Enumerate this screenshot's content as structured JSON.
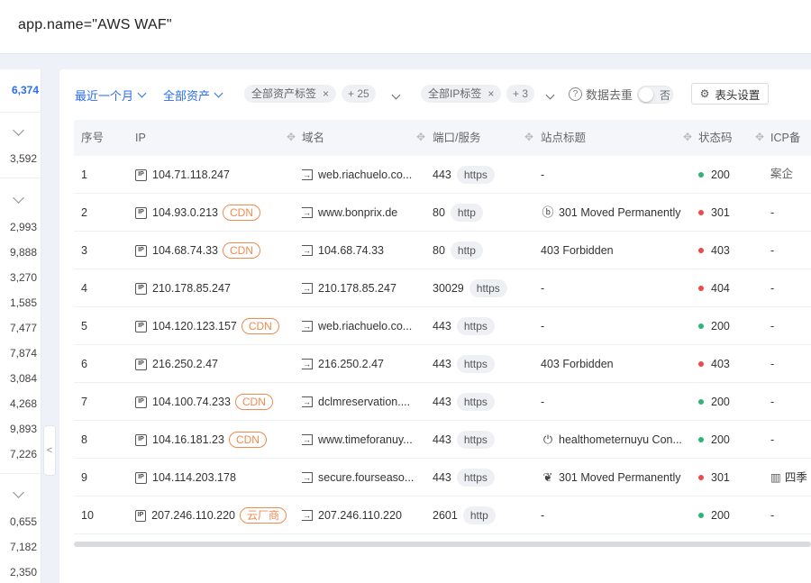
{
  "query": "app.name=\"AWS WAF\"",
  "sidebar": {
    "total": "6,374",
    "numbers": [
      "3,592",
      "2,993",
      "9,888",
      "3,270",
      "1,585",
      "7,477",
      "7,874",
      "3,084",
      "4,268",
      "9,893",
      "7,226",
      "0,655",
      "7,182",
      "2,350"
    ]
  },
  "collapse_label": "<",
  "filters": {
    "time_range": "最近一个月",
    "asset_scope": "全部资产",
    "asset_tag": "全部资产标签",
    "asset_tag_more": "+ 25",
    "ip_tag": "全部IP标签",
    "ip_tag_more": "+ 3",
    "dedupe_label": "数据去重",
    "dedupe_value": "否",
    "column_settings": "表头设置",
    "help_glyph": "?",
    "close_glyph": "×"
  },
  "columns": [
    "序号",
    "IP",
    "域名",
    "端口/服务",
    "站点标题",
    "状态码",
    "ICP备案企"
  ],
  "rows": [
    {
      "no": "1",
      "ip": "104.71.118.247",
      "badge": "",
      "domain": "web.riachuelo.co...",
      "port": "443",
      "service": "https",
      "site_icon": "",
      "title": "-",
      "status": "200",
      "status_color": "#2bb673",
      "icp_icon": "",
      "icp": "-"
    },
    {
      "no": "2",
      "ip": "104.93.0.213",
      "badge": "CDN",
      "domain": "www.bonprix.de",
      "port": "80",
      "service": "http",
      "site_icon": "ⓑ",
      "title": "301 Moved Permanently",
      "status": "301",
      "status_color": "#f0474a",
      "icp_icon": "",
      "icp": "-"
    },
    {
      "no": "3",
      "ip": "104.68.74.33",
      "badge": "CDN",
      "domain": "104.68.74.33",
      "port": "80",
      "service": "http",
      "site_icon": "",
      "title": "403 Forbidden",
      "status": "403",
      "status_color": "#f0474a",
      "icp_icon": "",
      "icp": "-"
    },
    {
      "no": "4",
      "ip": "210.178.85.247",
      "badge": "",
      "domain": "210.178.85.247",
      "port": "30029",
      "service": "https",
      "site_icon": "",
      "title": "-",
      "status": "404",
      "status_color": "#f0474a",
      "icp_icon": "",
      "icp": "-"
    },
    {
      "no": "5",
      "ip": "104.120.123.157",
      "badge": "CDN",
      "domain": "web.riachuelo.co...",
      "port": "443",
      "service": "https",
      "site_icon": "",
      "title": "-",
      "status": "200",
      "status_color": "#2bb673",
      "icp_icon": "",
      "icp": "-"
    },
    {
      "no": "6",
      "ip": "216.250.2.47",
      "badge": "",
      "domain": "216.250.2.47",
      "port": "443",
      "service": "https",
      "site_icon": "",
      "title": "403 Forbidden",
      "status": "403",
      "status_color": "#f0474a",
      "icp_icon": "",
      "icp": "-"
    },
    {
      "no": "7",
      "ip": "104.100.74.233",
      "badge": "CDN",
      "domain": "dclmreservation....",
      "port": "443",
      "service": "https",
      "site_icon": "",
      "title": "-",
      "status": "200",
      "status_color": "#2bb673",
      "icp_icon": "",
      "icp": "-"
    },
    {
      "no": "8",
      "ip": "104.16.181.23",
      "badge": "CDN",
      "domain": "www.timeforanuy...",
      "port": "443",
      "service": "https",
      "site_icon": "⏻",
      "title": "healthometernuyu Con...",
      "status": "200",
      "status_color": "#2bb673",
      "icp_icon": "",
      "icp": "-"
    },
    {
      "no": "9",
      "ip": "104.114.203.178",
      "badge": "",
      "domain": "secure.fourseaso...",
      "port": "443",
      "service": "https",
      "site_icon": "❦",
      "title": "301 Moved Permanently",
      "status": "301",
      "status_color": "#f0474a",
      "icp_icon": "▥",
      "icp": "四季"
    },
    {
      "no": "10",
      "ip": "207.246.110.220",
      "badge": "云厂商",
      "domain": "207.246.110.220",
      "port": "2601",
      "service": "http",
      "site_icon": "",
      "title": "-",
      "status": "200",
      "status_color": "#2bb673",
      "icp_icon": "",
      "icp": "-"
    }
  ],
  "icons": {
    "ip": "ip-icon",
    "domain": "open-link-icon",
    "settings": "gear-icon"
  }
}
